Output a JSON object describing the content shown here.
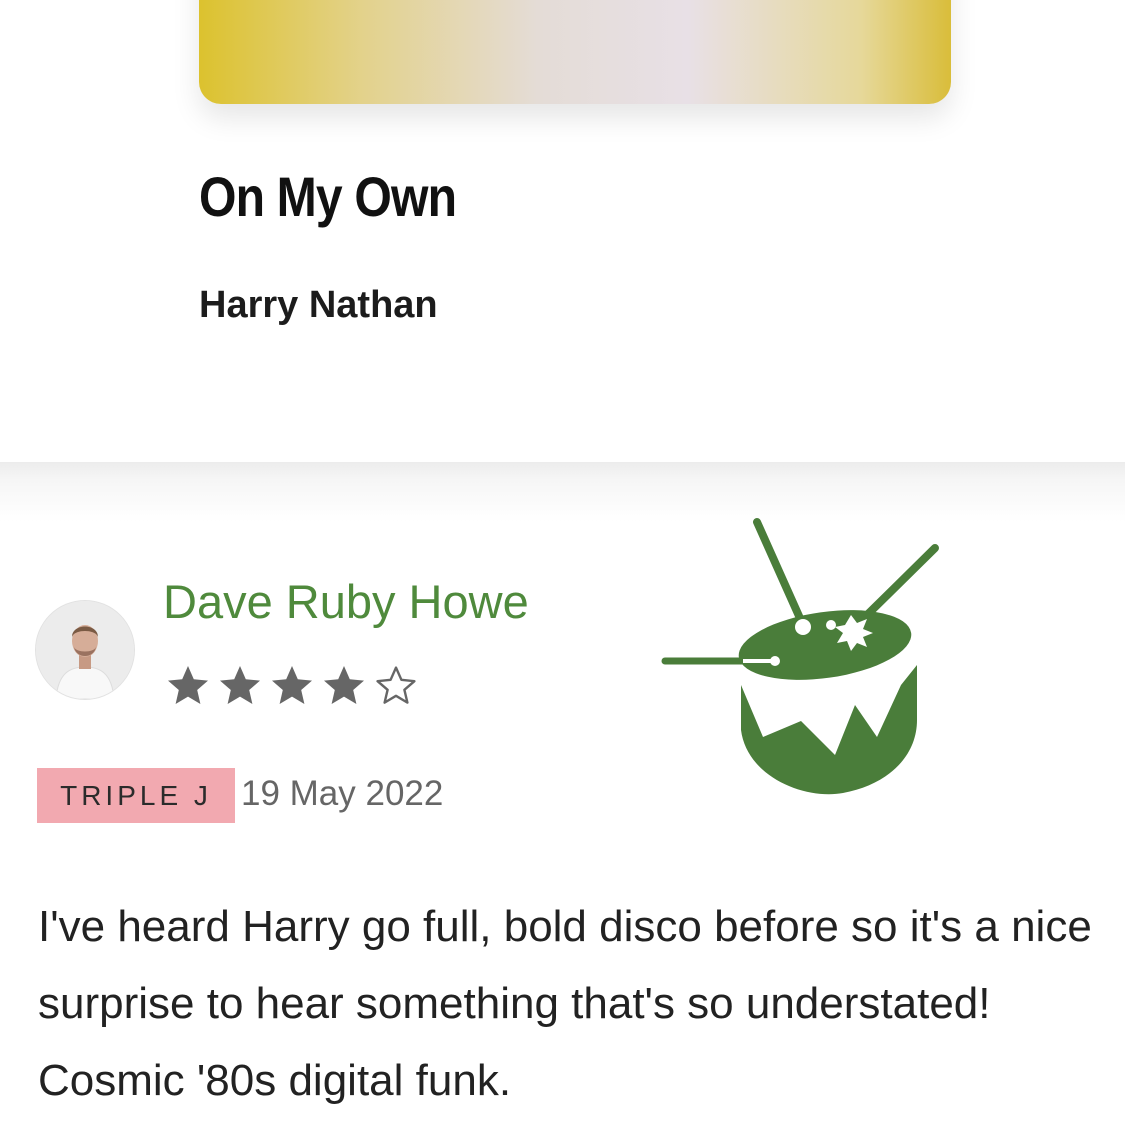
{
  "song": {
    "title": "On My Own",
    "artist": "Harry Nathan"
  },
  "review": {
    "reviewer_name": "Dave Ruby Howe",
    "rating": 4,
    "rating_max": 5,
    "station": "TRIPLE J",
    "date": "19 May 2022",
    "text": "I've heard Harry go full, bold disco before so it's a nice surprise to hear something that's so understated! Cosmic '80s digital funk."
  },
  "icons": {
    "avatar": "reviewer-avatar",
    "logo": "triple-j-drum-logo",
    "star_filled": "star-filled-icon",
    "star_empty": "star-outline-icon"
  },
  "colors": {
    "reviewer_name": "#4f8a3c",
    "logo": "#4a7d3a",
    "badge_bg": "#f2a9b0",
    "star": "#666666",
    "artwork_gradient": [
      "#dcc22e",
      "#e4dcd6",
      "#e8e0e6",
      "#d9bd3a"
    ]
  }
}
